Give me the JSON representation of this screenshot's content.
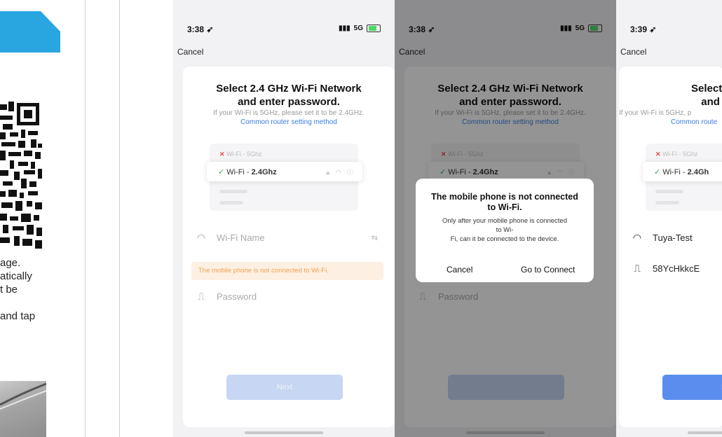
{
  "manual": {
    "text": "age.\natically\nt be\n\nand tap"
  },
  "phones": [
    {
      "time": "3:38",
      "network": "5G",
      "cancel_label": "Cancel",
      "title": "Select 2.4 GHz Wi-Fi Network\nand enter password.",
      "subtitle": "If your Wi-Fi is 5GHz, please set it to be 2.4GHz.",
      "link": "Common router setting method",
      "wifi_5g": "Wi-Fi - 5Ghz",
      "wifi_24_prefix": "Wi-Fi - ",
      "wifi_24_band": "2.4Ghz",
      "wifi_name_placeholder": "Wi-Fi Name",
      "warning": "The mobile phone is not connected to Wi-Fi.",
      "password_placeholder": "Password",
      "next_label": "Next"
    },
    {
      "time": "3:38",
      "network": "5G",
      "cancel_label": "Cancel",
      "title": "Select 2.4 GHz Wi-Fi Network\nand enter password.",
      "subtitle": "If your Wi-Fi is 5GHz, please set it to be 2.4GHz.",
      "link": "Common router setting method",
      "wifi_5g": "Wi-Fi - 5Ghz",
      "wifi_24_prefix": "Wi-Fi - ",
      "wifi_24_band": "2.4Ghz",
      "password_placeholder": "Password",
      "dialog": {
        "title": "The mobile phone is not connected\nto Wi-Fi.",
        "message": "Only after your mobile phone is connected\nto Wi-\nFi, can it be connected to the device.",
        "cancel": "Cancel",
        "confirm": "Go to Connect"
      }
    },
    {
      "time": "3:39",
      "cancel_label": "Cancel",
      "title": "Select 2.4 GH\nand enter",
      "subtitle": "If your Wi-Fi is 5GHz, p",
      "link": "Common route",
      "wifi_5g": "Wi-Fi - 5Ghz",
      "wifi_24_prefix": "Wi-Fi - ",
      "wifi_24_band": "2.4Gh",
      "wifi_name_value": "Tuya-Test",
      "password_value": "58YcHkkcE",
      "next_label": "N"
    }
  ]
}
